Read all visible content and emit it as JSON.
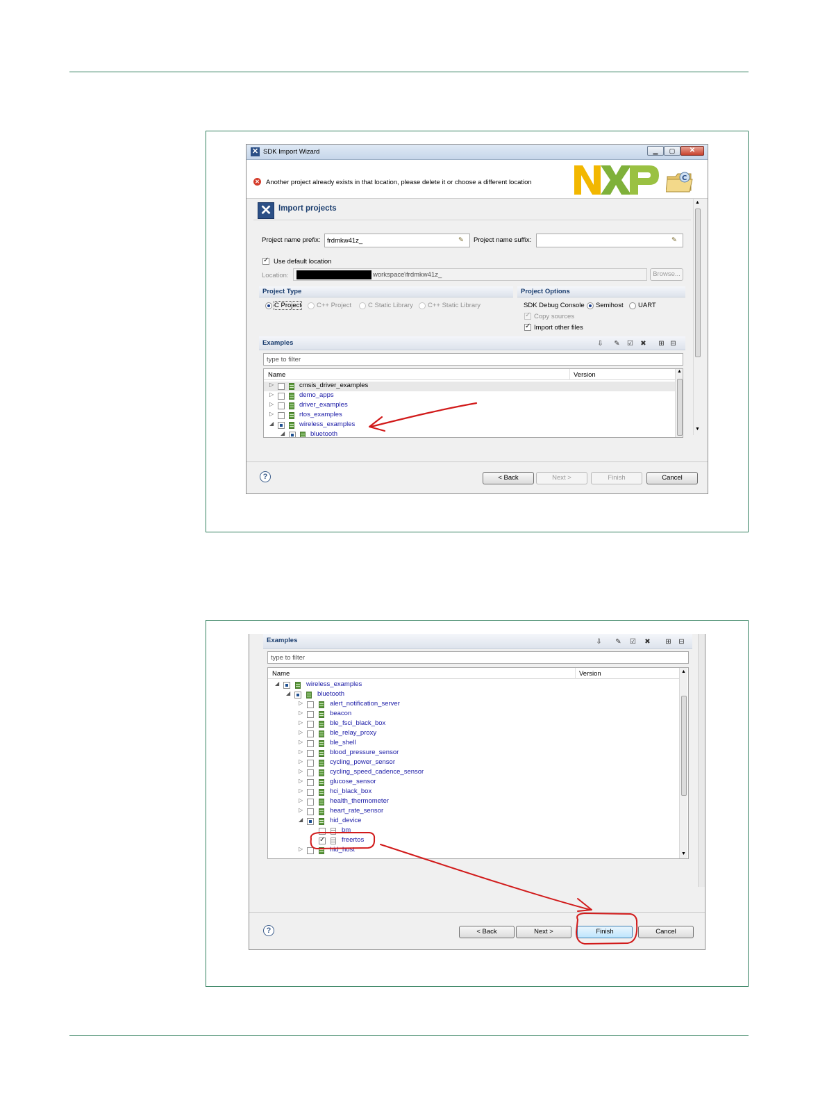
{
  "wizard1": {
    "title": "SDK Import Wizard",
    "error_message": "Another project already exists in that location, please delete it or choose a different location",
    "heading": "Import projects",
    "prefix_label": "Project name prefix:",
    "prefix_value": "frdmkw41z_",
    "suffix_label": "Project name suffix:",
    "suffix_value": "",
    "use_default_location": "Use default location",
    "location_label": "Location:",
    "location_value": "workspace\\frdmkw41z_",
    "browse": "Browse...",
    "project_type": {
      "title": "Project Type",
      "options": [
        "C Project",
        "C++ Project",
        "C Static Library",
        "C++ Static Library"
      ]
    },
    "project_options": {
      "title": "Project Options",
      "debug_console": "SDK Debug Console",
      "semihost": "Semihost",
      "uart": "UART",
      "copy_sources": "Copy sources",
      "import_other": "Import other files"
    },
    "examples": {
      "title": "Examples",
      "filter_placeholder": "type to filter",
      "col_name": "Name",
      "col_version": "Version",
      "items": [
        "cmsis_driver_examples",
        "demo_apps",
        "driver_examples",
        "rtos_examples",
        "wireless_examples",
        "bluetooth"
      ]
    },
    "buttons": {
      "back": "< Back",
      "next": "Next >",
      "finish": "Finish",
      "cancel": "Cancel"
    },
    "help": "?"
  },
  "wizard2": {
    "examples": {
      "title": "Examples",
      "filter_placeholder": "type to filter",
      "col_name": "Name",
      "col_version": "Version",
      "items": [
        "wireless_examples",
        "bluetooth",
        "alert_notification_server",
        "beacon",
        "ble_fsci_black_box",
        "ble_relay_proxy",
        "ble_shell",
        "blood_pressure_sensor",
        "cycling_power_sensor",
        "cycling_speed_cadence_sensor",
        "glucose_sensor",
        "hci_black_box",
        "health_thermometer",
        "heart_rate_sensor",
        "hid_device",
        "bm",
        "freertos",
        "hid_host"
      ]
    },
    "buttons": {
      "back": "< Back",
      "next": "Next >",
      "finish": "Finish",
      "cancel": "Cancel"
    },
    "help": "?"
  },
  "colors": {
    "rule": "#2e7d5b",
    "annotation": "#d11a1a",
    "link_text": "#1a1aa6"
  }
}
